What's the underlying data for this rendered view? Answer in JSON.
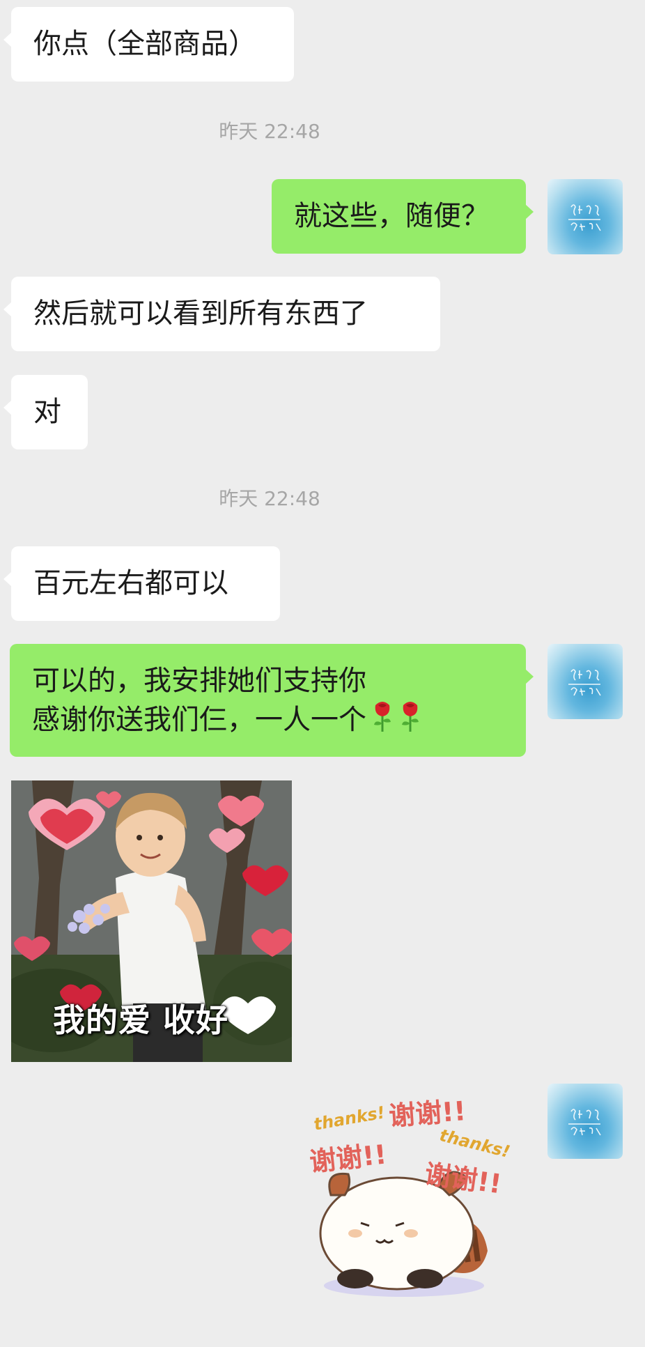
{
  "messages": {
    "m1": "你点（全部商品）",
    "t1": "昨天 22:48",
    "m2": "就这些，随便？",
    "m3": "然后就可以看到所有东西了",
    "m4": "对",
    "t2": "昨天 22:48",
    "m5": "百元左右都可以",
    "m6_line1": "可以的，我安排她们支持你",
    "m6_line2": "感谢你送我们仨，一人一个"
  },
  "image_message": {
    "caption": "我的爱 收好"
  },
  "sticker": {
    "thanks_1": "thanks!",
    "thanks_2": "thanks!",
    "xie_1": "谢谢!!",
    "xie_2": "谢谢!!",
    "xie_3": "谢谢!!"
  },
  "icons": {
    "rose": "rose-emoji",
    "avatar": "user-avatar"
  },
  "colors": {
    "background": "#ededed",
    "outgoing_bubble": "#95ec69",
    "incoming_bubble": "#ffffff",
    "timestamp": "#a6a6a6"
  }
}
